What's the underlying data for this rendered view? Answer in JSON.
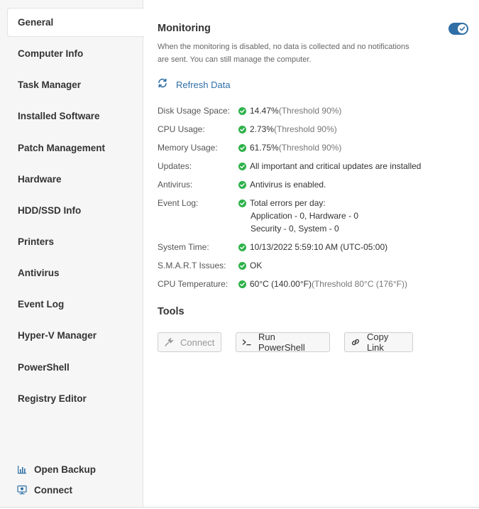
{
  "sidebar": {
    "items": [
      {
        "label": "General",
        "active": true
      },
      {
        "label": "Computer Info"
      },
      {
        "label": "Task Manager"
      },
      {
        "label": "Installed Software"
      },
      {
        "label": "Patch Management"
      },
      {
        "label": "Hardware"
      },
      {
        "label": "HDD/SSD Info"
      },
      {
        "label": "Printers"
      },
      {
        "label": "Antivirus"
      },
      {
        "label": "Event Log"
      },
      {
        "label": "Hyper-V Manager"
      },
      {
        "label": "PowerShell"
      },
      {
        "label": "Registry Editor"
      }
    ],
    "bottom_links": [
      {
        "label": "Open Backup",
        "icon": "bar-chart-icon"
      },
      {
        "label": "Connect",
        "icon": "monitor-icon"
      }
    ]
  },
  "monitoring": {
    "title": "Monitoring",
    "enabled": true,
    "description": "When the monitoring is disabled, no data is collected and no notifications are sent. You can still manage the computer.",
    "refresh_label": "Refresh Data",
    "rows": [
      {
        "label": "Disk Usage Space:",
        "value": "14.47%",
        "extra": " (Threshold 90%)"
      },
      {
        "label": "CPU Usage:",
        "value": "2.73%",
        "extra": " (Threshold 90%)"
      },
      {
        "label": "Memory Usage:",
        "value": "61.75%",
        "extra": " (Threshold 90%)"
      },
      {
        "label": "Updates:",
        "value": "All important and critical updates are installed",
        "extra": ""
      },
      {
        "label": "Antivirus:",
        "value": "Antivirus is enabled.",
        "extra": ""
      },
      {
        "label": "Event Log:",
        "value": "Total errors per day:",
        "line2": "Application - 0, Hardware - 0",
        "line3": "Security - 0, System - 0"
      },
      {
        "label": "System Time:",
        "value": "10/13/2022 5:59:10 AM (UTC-05:00)",
        "extra": ""
      },
      {
        "label": "S.M.A.R.T Issues:",
        "value": "OK",
        "extra": ""
      },
      {
        "label": "CPU Temperature:",
        "value": "60°C (140.00°F)",
        "extra": " (Threshold 80°C (176°F))"
      }
    ]
  },
  "tools": {
    "title": "Tools",
    "buttons": [
      {
        "label": "Connect",
        "disabled": true
      },
      {
        "label": "Run PowerShell"
      },
      {
        "label": "Copy Link"
      }
    ]
  },
  "colors": {
    "accent": "#2f6fa6",
    "success": "#2eb24a"
  }
}
